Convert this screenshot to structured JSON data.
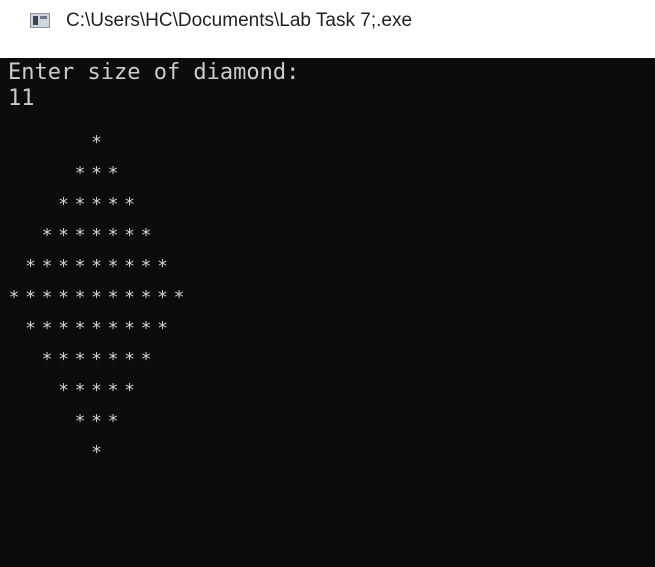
{
  "window": {
    "title": "C:\\Users\\HC\\Documents\\Lab Task 7;.exe",
    "icon": "console-app-icon"
  },
  "console": {
    "prompt": "Enter size of diamond:",
    "input_value": "11",
    "star_char": "*",
    "diamond_size": 11,
    "rows": [
      1,
      3,
      5,
      7,
      9,
      11,
      9,
      7,
      5,
      3,
      1
    ],
    "background_color": "#0c0c0c",
    "text_color": "#cccccc"
  }
}
